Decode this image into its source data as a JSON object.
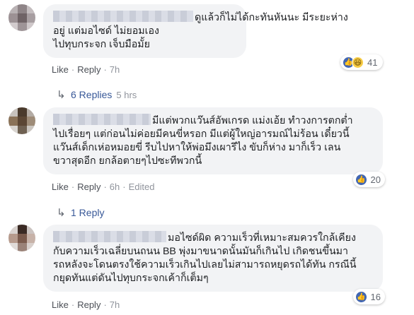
{
  "comments": [
    {
      "lines": [
        "ดูแล้วก็ไม่ได้กะทันหันนะ มีระยะห่าง",
        "อยู่ แต่มอไซด์ ไม่ยอมเอง",
        "ไปทุบกระจก เจ็บมือมั้ย"
      ],
      "like_label": "Like",
      "reply_label": "Reply",
      "time": "7h",
      "edited": "",
      "reaction_count": "41",
      "reaction_icons": [
        "like-icon",
        "haha-icon"
      ],
      "replies_label": "6 Replies",
      "replies_time": "5 hrs"
    },
    {
      "lines": [
        "มีแต่พวกแว๊นส์อัพเกรด แม่งเอ้ย ทำวงการตกต่ำ",
        "ไปเรื่อยๆ แต่ก่อนไม่ค่อยมีคนขี่หรอก มีแต่ผู้ใหญ่อารมณ์ไม่ร้อน เดี๋ยวนี้",
        "แว๊นส์เด็กเห่อหมอยขี่ รีบไปหาให้พ่อมึงเผารึไง ขับก็ห่าง มาก็เร็ว เลน",
        "ขวาสุดอีก ยกล้อตายๆไปซะทีพวกนี้"
      ],
      "like_label": "Like",
      "reply_label": "Reply",
      "time": "6h",
      "edited": "Edited",
      "reaction_count": "20",
      "reaction_icons": [
        "like-icon"
      ],
      "replies_label": "1 Reply",
      "replies_time": ""
    },
    {
      "lines": [
        "มอไซด์ผิด ความเร็วที่เหมาะสมควรใกล้เคียง",
        "กับความเร็วเฉลี่ยบนถนน BB พุ่งมาขนาดนั้นมันก็เกินไป เกิดชนขึ้นมา",
        "รถหลังจะโดนตรงใช้ความเร็วเกินไปเลยไม่สามารถหยุดรถได้ทัน กรณีนี้",
        "กยุดทันแต่ดันไปทุบกระจกเค้าก็เต็มๆ"
      ],
      "like_label": "Like",
      "reply_label": "Reply",
      "time": "7h",
      "edited": "",
      "reaction_count": "16",
      "reaction_icons": [
        "like-icon"
      ],
      "replies_label": "",
      "replies_time": ""
    }
  ],
  "colors": {
    "bubble": "#f2f3f5",
    "link": "#385898",
    "like_blue": "#4267b2",
    "meta": "#616770"
  }
}
